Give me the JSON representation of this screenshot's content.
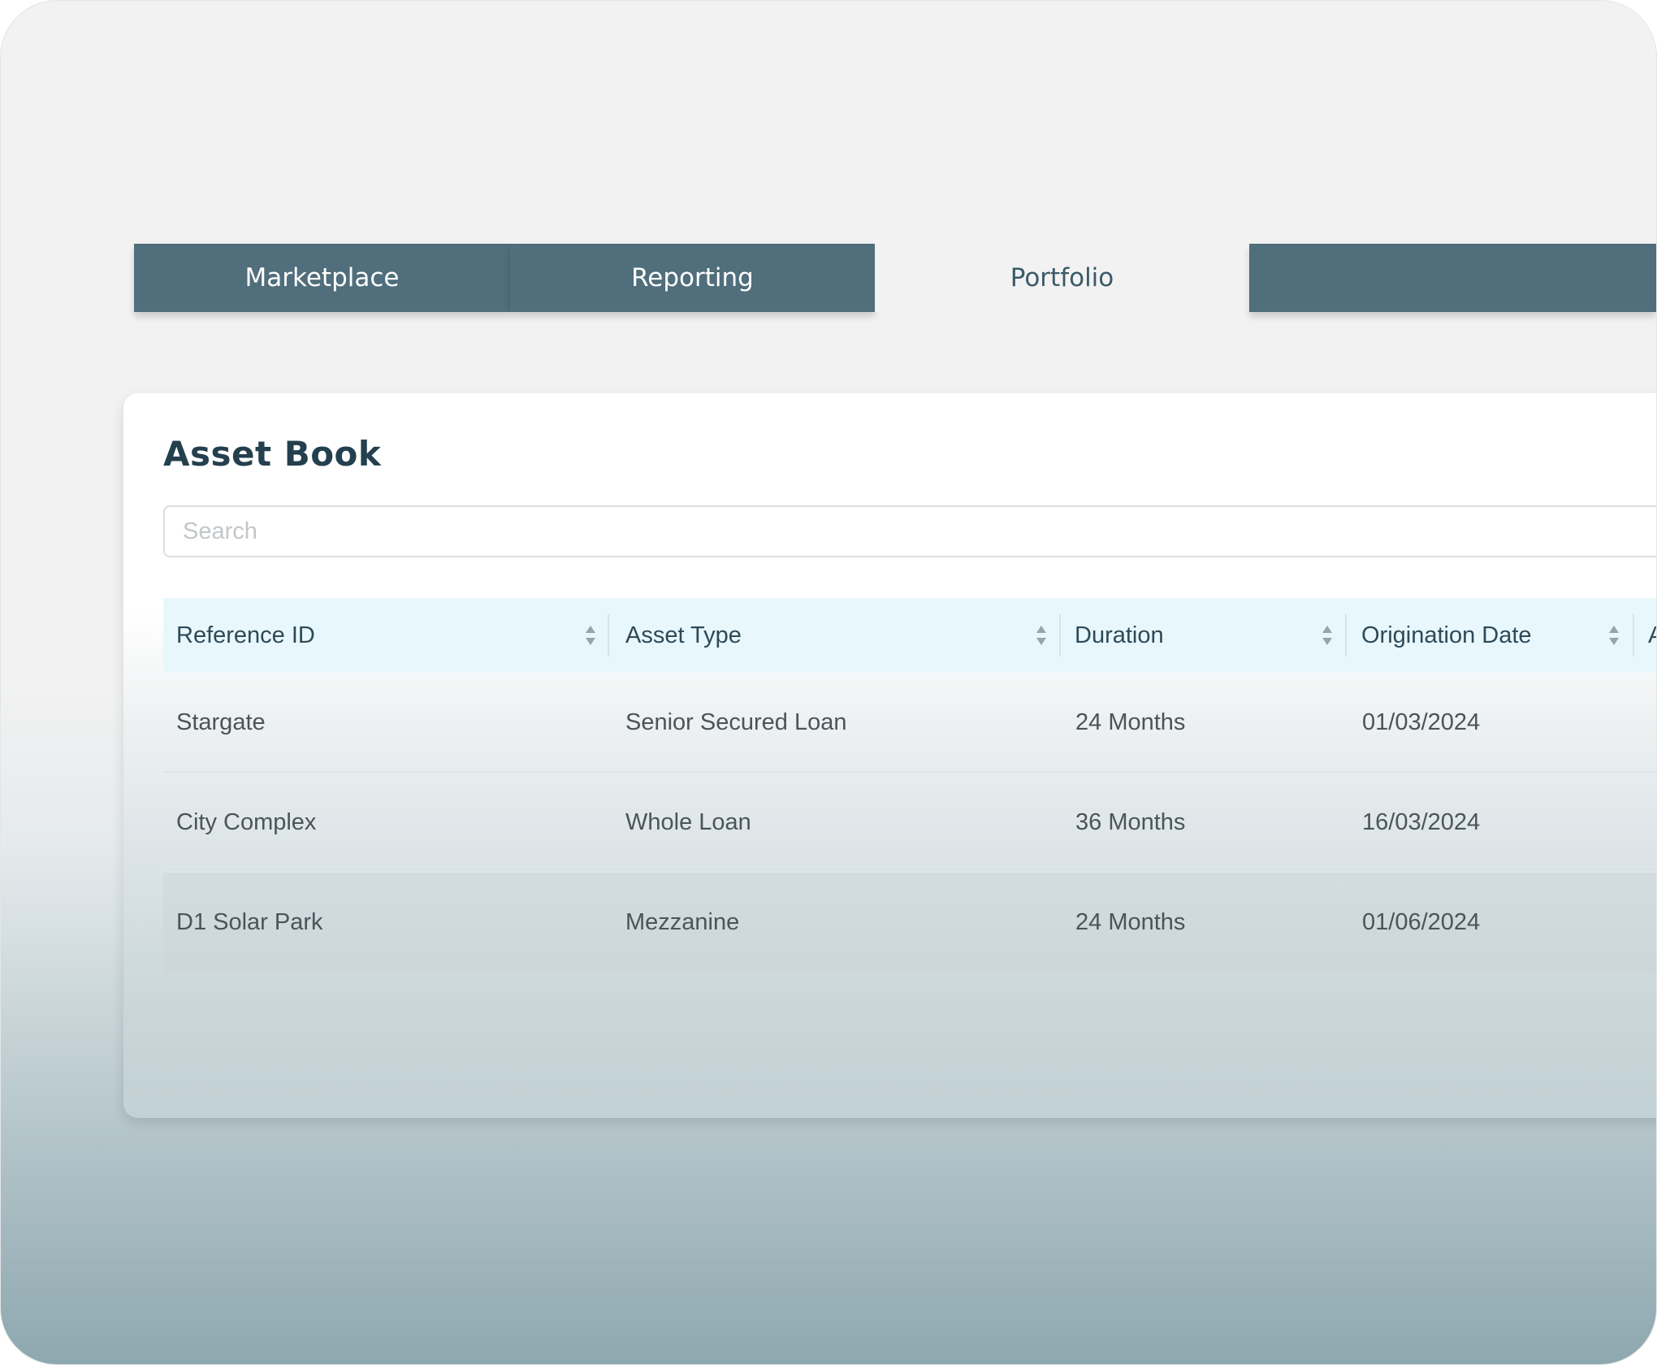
{
  "nav": {
    "tabs": [
      {
        "label": "Marketplace",
        "active": false
      },
      {
        "label": "Reporting",
        "active": false
      },
      {
        "label": "Portfolio",
        "active": true
      }
    ]
  },
  "card": {
    "title": "Asset Book",
    "search": {
      "placeholder": "Search",
      "value": ""
    }
  },
  "table": {
    "columns": [
      {
        "label": "Reference ID",
        "sortable": true
      },
      {
        "label": "Asset Type",
        "sortable": true
      },
      {
        "label": "Duration",
        "sortable": true
      },
      {
        "label": "Origination Date",
        "sortable": true
      },
      {
        "label": "A",
        "sortable": false
      }
    ],
    "rows": [
      [
        "Stargate",
        "Senior Secured Loan",
        "24 Months",
        "01/03/2024"
      ],
      [
        "City Complex",
        "Whole Loan",
        "36 Months",
        "16/03/2024"
      ],
      [
        "D1 Solar Park",
        "Mezzanine",
        "24 Months",
        "01/06/2024"
      ]
    ]
  },
  "colors": {
    "tab_inactive_bg": "#506e7b",
    "tab_active_text": "#3a5a68",
    "title_text": "#243f4d",
    "header_bg": "#e8f7fc"
  }
}
